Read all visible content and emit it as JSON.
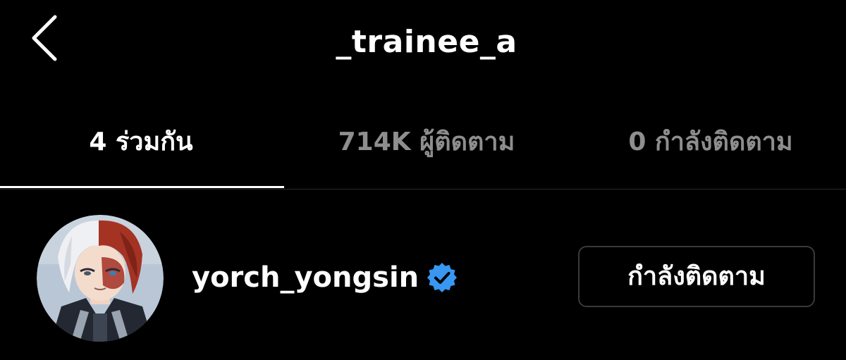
{
  "header": {
    "title": "_trainee_a",
    "back_icon": "chevron-left-icon"
  },
  "tabs": [
    {
      "label": "4 ร่วมกัน",
      "active": true
    },
    {
      "label": "714K ผู้ติดตาม",
      "active": false
    },
    {
      "label": "0 กำลังติดตาม",
      "active": false
    }
  ],
  "list": [
    {
      "username": "yorch_yongsin",
      "verified": true,
      "verified_icon": "verified-badge-icon",
      "button_label": "กำลังติดตาม"
    }
  ],
  "colors": {
    "background": "#000000",
    "text_primary": "#ffffff",
    "text_secondary": "#8e8e8e",
    "verified_blue": "#3897f0",
    "button_border": "#3a3a3a"
  }
}
